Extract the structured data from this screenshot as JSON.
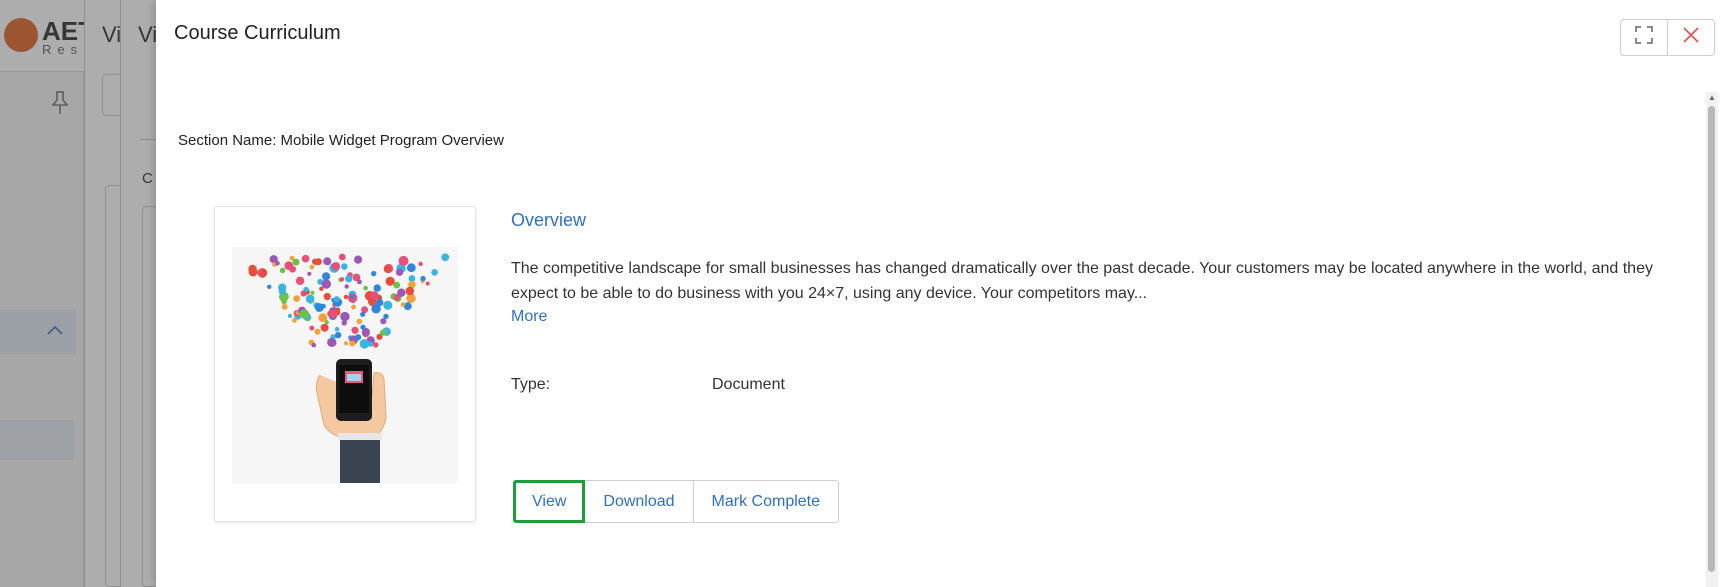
{
  "background": {
    "logo_text": "AET",
    "logo_sub": "Res",
    "title_fragment_a": "Vi",
    "title_fragment_b": "Vi",
    "column_fragment": "C"
  },
  "drawer": {
    "title": "Course Curriculum",
    "section_label": "Section Name: Mobile Widget Program Overview",
    "item": {
      "title": "Overview",
      "description": "The competitive landscape for small businesses has changed dramatically over the past decade. Your customers may be located anywhere in the world, and they expect to be able to do business with you 24×7, using any device. Your competitors may...",
      "more_label": "More",
      "type_label": "Type:",
      "type_value": "Document"
    },
    "actions": {
      "view": "View",
      "download": "Download",
      "mark_complete": "Mark Complete"
    }
  },
  "colors": {
    "link": "#2f6fc4",
    "focus_ring": "#1e9e3a",
    "close_icon": "#d9534f",
    "logo": "#e06a2a"
  },
  "icons": {
    "expand": "fullscreen-expand-icon",
    "close": "close-x-icon",
    "pin": "pin-icon",
    "chevron": "chevron-up-icon"
  }
}
